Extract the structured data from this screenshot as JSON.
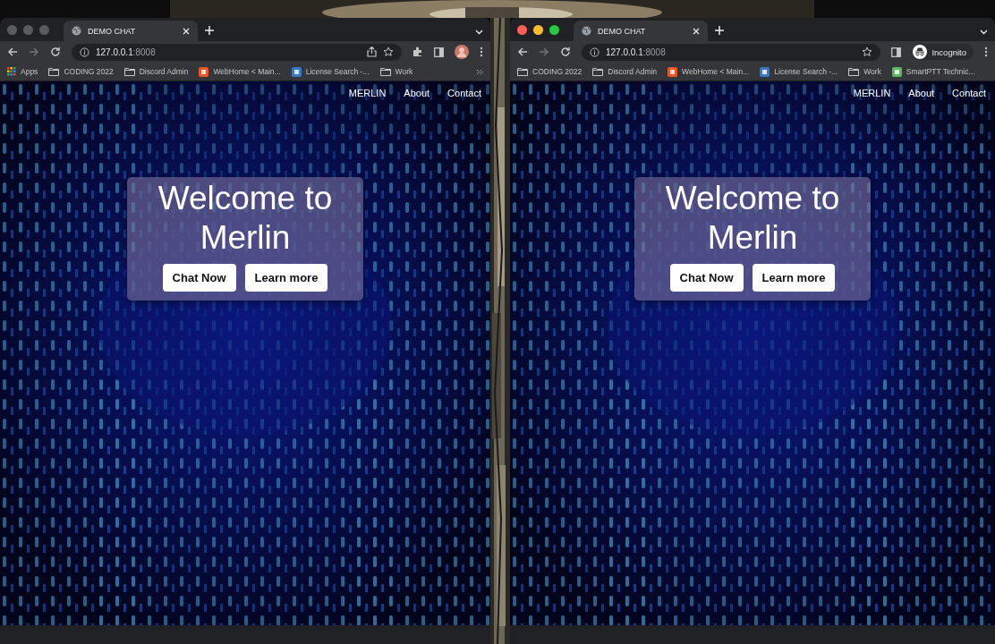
{
  "windows": [
    {
      "focused": false,
      "tab": {
        "title": "DEMO CHAT"
      },
      "url": {
        "host": "127.0.0.1",
        "port": ":8008"
      },
      "address_icons": [
        {
          "kind": "share"
        },
        {
          "kind": "star"
        }
      ],
      "toolbar": [
        {
          "kind": "extensions"
        },
        {
          "kind": "side-panel"
        },
        {
          "kind": "avatar"
        }
      ],
      "bookmarks": [
        {
          "kind": "apps",
          "label": "Apps"
        },
        {
          "kind": "folder",
          "label": "CODING 2022"
        },
        {
          "kind": "folder",
          "label": "Discord Admin"
        },
        {
          "kind": "site",
          "label": "WebHome < Main...",
          "color": "#e8562a"
        },
        {
          "kind": "site",
          "label": "License Search -...",
          "color": "#3b78c4"
        },
        {
          "kind": "folder",
          "label": "Work"
        }
      ],
      "nav": [
        "MERLIN",
        "About",
        "Contact"
      ],
      "hero": {
        "title": "Welcome to Merlin",
        "buttons": [
          "Chat Now",
          "Learn more"
        ]
      }
    },
    {
      "focused": true,
      "tab": {
        "title": "DEMO CHAT"
      },
      "url": {
        "host": "127.0.0.1",
        "port": ":8008"
      },
      "address_icons": [
        {
          "kind": "star"
        }
      ],
      "toolbar": [
        {
          "kind": "side-panel"
        },
        {
          "kind": "incognito",
          "label": "Incognito"
        }
      ],
      "bookmarks": [
        {
          "kind": "folder",
          "label": "CODING 2022"
        },
        {
          "kind": "folder",
          "label": "Discord Admin"
        },
        {
          "kind": "site",
          "label": "WebHome < Main...",
          "color": "#e8562a"
        },
        {
          "kind": "site",
          "label": "License Search -...",
          "color": "#3b78c4"
        },
        {
          "kind": "folder",
          "label": "Work"
        },
        {
          "kind": "site",
          "label": "SmartPTT Technic...",
          "color": "#5cb85c"
        }
      ],
      "nav": [
        "MERLIN",
        "About",
        "Contact"
      ],
      "hero": {
        "title": "Welcome to Merlin",
        "buttons": [
          "Chat Now",
          "Learn more"
        ]
      }
    }
  ]
}
